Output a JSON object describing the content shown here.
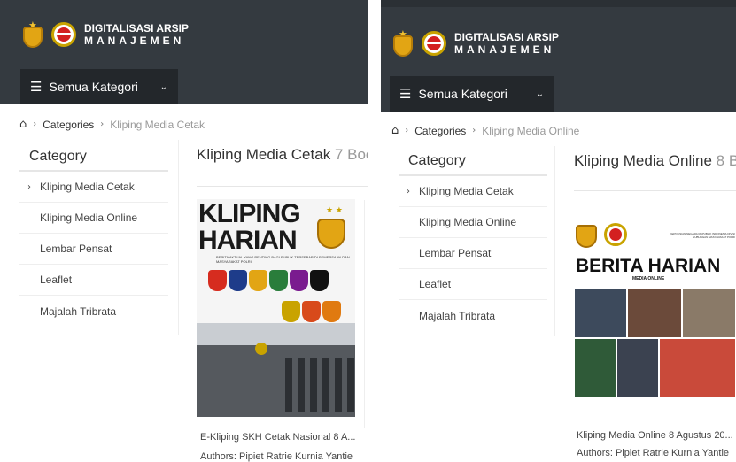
{
  "brand": {
    "line1": "DIGITALISASI ARSIP",
    "line2": "MANAJEMEN"
  },
  "category_button": {
    "label": "Semua Kategori"
  },
  "sidebar": {
    "heading": "Category",
    "items": [
      "Kliping Media Cetak",
      "Kliping Media Online",
      "Lembar Pensat",
      "Leaflet",
      "Majalah Tribrata"
    ]
  },
  "left": {
    "breadcrumb": {
      "categories": "Categories",
      "current": "Kliping Media Cetak"
    },
    "title": "Kliping Media Cetak",
    "count": "7 Boo",
    "cover": {
      "line1": "KLIPING",
      "line2": "HARIAN",
      "subtitle": "BERITA AKTUAL YANG PENTING BAGI PUBLIK TERSEBAR DI PEMERSAAN DAN MASYARAKAT POLRI"
    },
    "card": {
      "title": "E-Kliping SKH Cetak Nasional 8 A...",
      "authors": "Authors: Pipiet Ratrie Kurnia Yantie"
    }
  },
  "right": {
    "breadcrumb": {
      "categories": "Categories",
      "current": "Kliping Media Online"
    },
    "title": "Kliping Media Online",
    "count": "8 B",
    "cover": {
      "top": "KEPOLISIAN NEGARA REPUBLIK INDONESIA DIVISI HUBUNGAN MASYARAKAT POLRI",
      "title": "BERITA HARIAN",
      "subtitle": "MEDIA ONLINE"
    },
    "card": {
      "title": "Kliping Media Online 8 Agustus 20...",
      "authors": "Authors: Pipiet Ratrie Kurnia Yantie"
    }
  },
  "colors": {
    "header": "#343a40",
    "button": "#23272b",
    "emblems": [
      "#d62c1f",
      "#1e3c8a",
      "#e2a514",
      "#2a7d3b",
      "#7a1b8f",
      "#111111",
      "#c9a300",
      "#d84a1b",
      "#e07a10"
    ]
  }
}
